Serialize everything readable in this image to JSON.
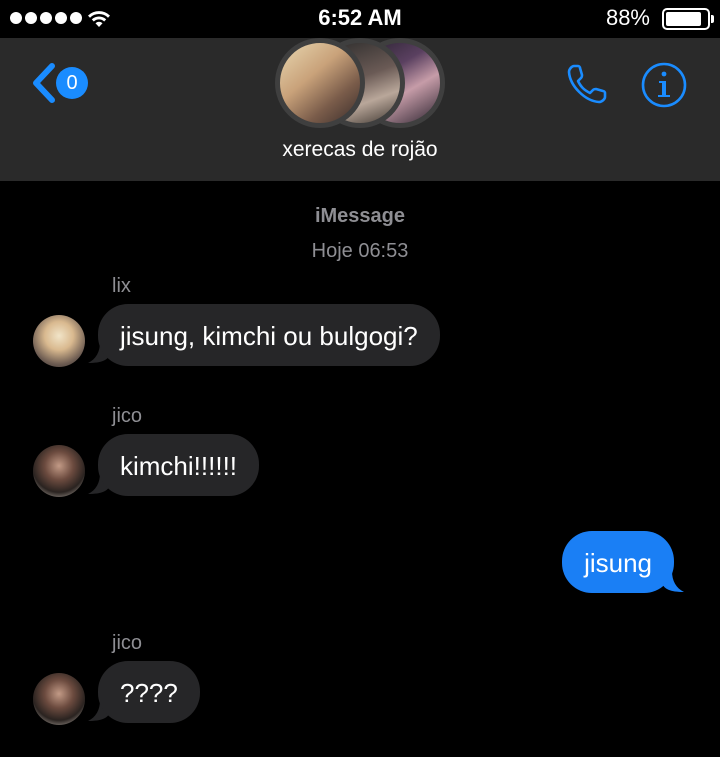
{
  "status_bar": {
    "time": "6:52 AM",
    "battery_percent": "88%",
    "battery_level": 0.88,
    "signal_bars": 5,
    "icons": [
      "signal-dots-icon",
      "wifi-icon",
      "battery-icon"
    ]
  },
  "header": {
    "back_badge": "0",
    "group_name": "xerecas de rojão",
    "icons": [
      "back-chevron-icon",
      "phone-icon",
      "info-icon"
    ],
    "accent_color": "#1a8cff"
  },
  "conversation": {
    "service": "iMessage",
    "timestamp": "Hoje 06:53",
    "messages": [
      {
        "sender": "lix",
        "text": "jisung, kimchi ou bulgogi?",
        "direction": "incoming"
      },
      {
        "sender": "jico",
        "text": "kimchi!!!!!!",
        "direction": "incoming"
      },
      {
        "sender": "",
        "text": "jisung",
        "direction": "outgoing"
      },
      {
        "sender": "jico",
        "text": "????",
        "direction": "incoming"
      }
    ],
    "colors": {
      "incoming_bubble": "#262628",
      "outgoing_bubble": "#1a7ff5"
    }
  }
}
